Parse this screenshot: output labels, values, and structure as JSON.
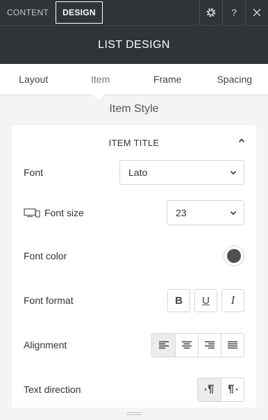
{
  "topbar": {
    "tabs": [
      {
        "label": "CONTENT",
        "active": false
      },
      {
        "label": "DESIGN",
        "active": true
      }
    ],
    "icons": [
      "gear-icon",
      "help-icon",
      "close-icon"
    ],
    "help_label": "?"
  },
  "title": "LIST DESIGN",
  "subtabs": [
    {
      "label": "Layout",
      "active": false
    },
    {
      "label": "Item",
      "active": true
    },
    {
      "label": "Frame",
      "active": false
    },
    {
      "label": "Spacing",
      "active": false
    }
  ],
  "section_heading": "Item Style",
  "card": {
    "header": "ITEM TITLE",
    "font": {
      "label": "Font",
      "value": "Lato"
    },
    "font_size": {
      "label": "Font size",
      "value": "23",
      "icon": "desktop-mobile-icon"
    },
    "font_color": {
      "label": "Font color",
      "color": "#505050"
    },
    "font_format": {
      "label": "Font format",
      "options": [
        "B",
        "U",
        "I"
      ]
    },
    "alignment": {
      "label": "Alignment",
      "options": [
        "left",
        "center",
        "right",
        "justify"
      ],
      "selected": "left"
    },
    "text_direction": {
      "label": "Text direction",
      "options": [
        "ltr",
        "rtl"
      ],
      "selected": "ltr"
    }
  },
  "colors": {
    "topbar_bg": "#2f3437",
    "panel_bg": "#f4f4f4",
    "text": "#333333"
  }
}
